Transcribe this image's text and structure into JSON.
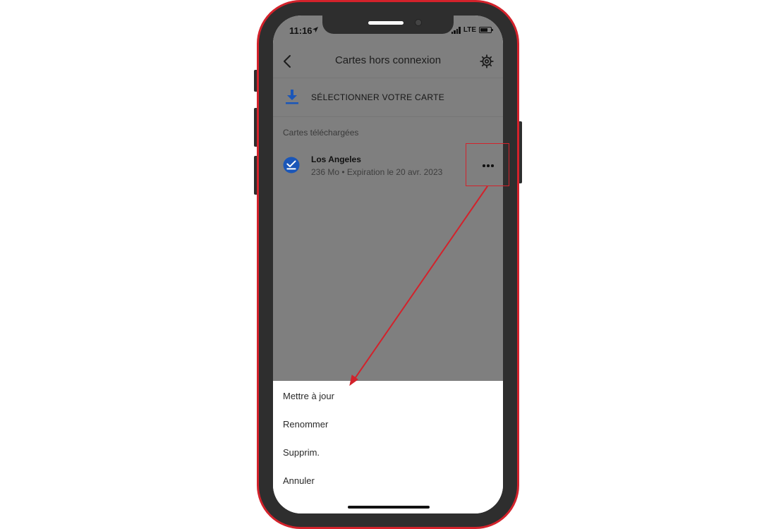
{
  "status_bar": {
    "time": "11:16",
    "network": "LTE",
    "battery_level": 0.7
  },
  "header": {
    "title": "Cartes hors connexion",
    "back_icon": "chevron-left-icon",
    "settings_icon": "gear-icon"
  },
  "select_map": {
    "label": "SÉLECTIONNER VOTRE CARTE",
    "icon": "download-icon"
  },
  "downloaded": {
    "section_label": "Cartes téléchargées",
    "items": [
      {
        "name": "Los Angeles",
        "meta": "236 Mo • Expiration le 20 avr. 2023",
        "icon": "check-circle-icon",
        "more_icon": "more-horizontal-icon"
      }
    ]
  },
  "sheet": {
    "items": [
      "Mettre à jour",
      "Renommer",
      "Supprim.",
      "Annuler"
    ]
  },
  "colors": {
    "annotation": "#d3222b",
    "accent_blue": "#1a56b8",
    "overlay_gray": "#7f7f7f",
    "phone_body": "#2e2e2e"
  }
}
